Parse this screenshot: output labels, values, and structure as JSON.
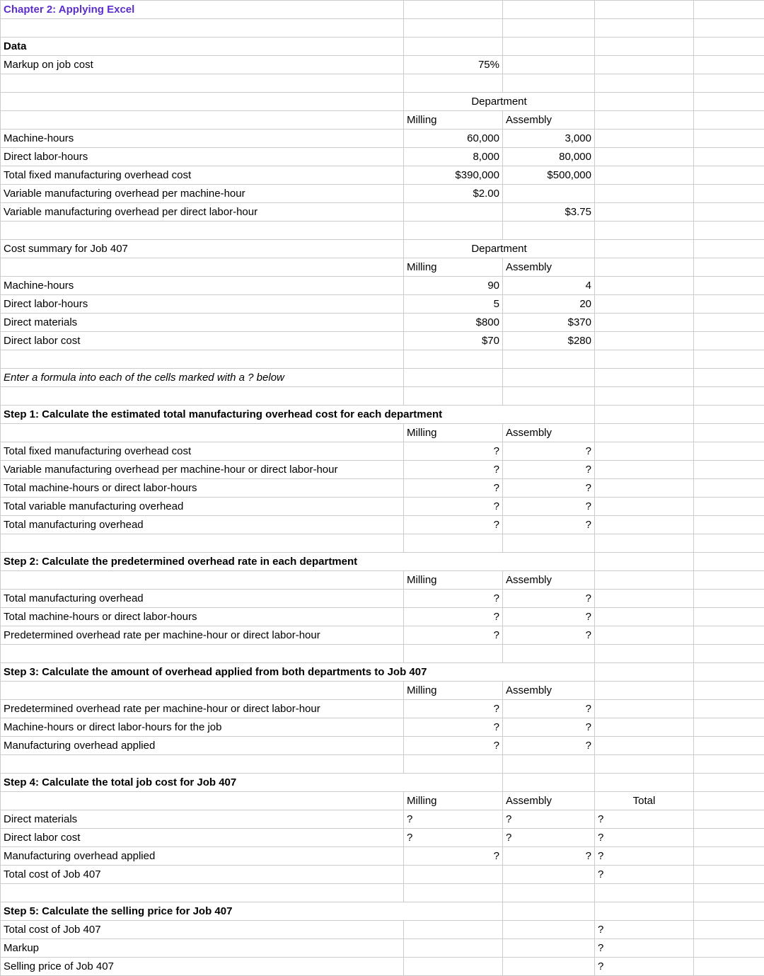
{
  "title": "Chapter 2: Applying Excel",
  "labels": {
    "data": "Data",
    "markup": "Markup on job cost",
    "department": "Department",
    "milling": "Milling",
    "assembly": "Assembly",
    "total": "Total",
    "mh": "Machine-hours",
    "dlh": "Direct labor-hours",
    "tfmoc": "Total fixed manufacturing overhead cost",
    "vmo_mh": "Variable manufacturing overhead per machine-hour",
    "vmo_dlh": "Variable manufacturing overhead per direct labor-hour",
    "cost_summary": "Cost summary for Job 407",
    "dm": "Direct materials",
    "dlc": "Direct labor cost",
    "instruction": "Enter a formula into each of the cells marked with a ? below",
    "step1": "Step 1: Calculate the estimated total manufacturing overhead cost for each department",
    "s1_tfmoc": "Total fixed manufacturing overhead cost",
    "s1_vmo": "Variable manufacturing overhead per machine-hour or direct labor-hour",
    "s1_tmh": "Total machine-hours or direct labor-hours",
    "s1_tvmo": "Total variable manufacturing overhead",
    "s1_tmo": "Total manufacturing overhead",
    "step2": "Step 2: Calculate the predetermined overhead rate in each department",
    "s2_tmo": "Total manufacturing overhead",
    "s2_tmh": "Total machine-hours or direct labor-hours",
    "s2_por": "Predetermined overhead rate per machine-hour or direct labor-hour",
    "step3": "Step 3: Calculate the amount of overhead applied from both departments to Job 407",
    "s3_por": "Predetermined overhead rate per machine-hour or direct labor-hour",
    "s3_hours": "Machine-hours or direct labor-hours for the job",
    "s3_moa": "Manufacturing overhead applied",
    "step4": "Step 4: Calculate the total job cost for Job 407",
    "s4_dm": "Direct materials",
    "s4_dlc": "Direct labor cost",
    "s4_moa": "Manufacturing overhead applied",
    "s4_tot": "Total cost of Job 407",
    "step5": "Step 5: Calculate the selling price for Job 407",
    "s5_tot": "Total cost of Job 407",
    "s5_markup": "Markup",
    "s5_sp": "Selling price of Job 407"
  },
  "values": {
    "markup": "75%",
    "dept": {
      "mh": {
        "milling": "60,000",
        "assembly": "3,000"
      },
      "dlh": {
        "milling": "8,000",
        "assembly": "80,000"
      },
      "tfmoc": {
        "milling": "$390,000",
        "assembly": "$500,000"
      },
      "vmo_mh": {
        "milling": "$2.00",
        "assembly": ""
      },
      "vmo_dlh": {
        "milling": "",
        "assembly": "$3.75"
      }
    },
    "job407": {
      "mh": {
        "milling": "90",
        "assembly": "4"
      },
      "dlh": {
        "milling": "5",
        "assembly": "20"
      },
      "dm": {
        "milling": "$800",
        "assembly": "$370"
      },
      "dlc": {
        "milling": "$70",
        "assembly": "$280"
      }
    },
    "q": "?"
  }
}
